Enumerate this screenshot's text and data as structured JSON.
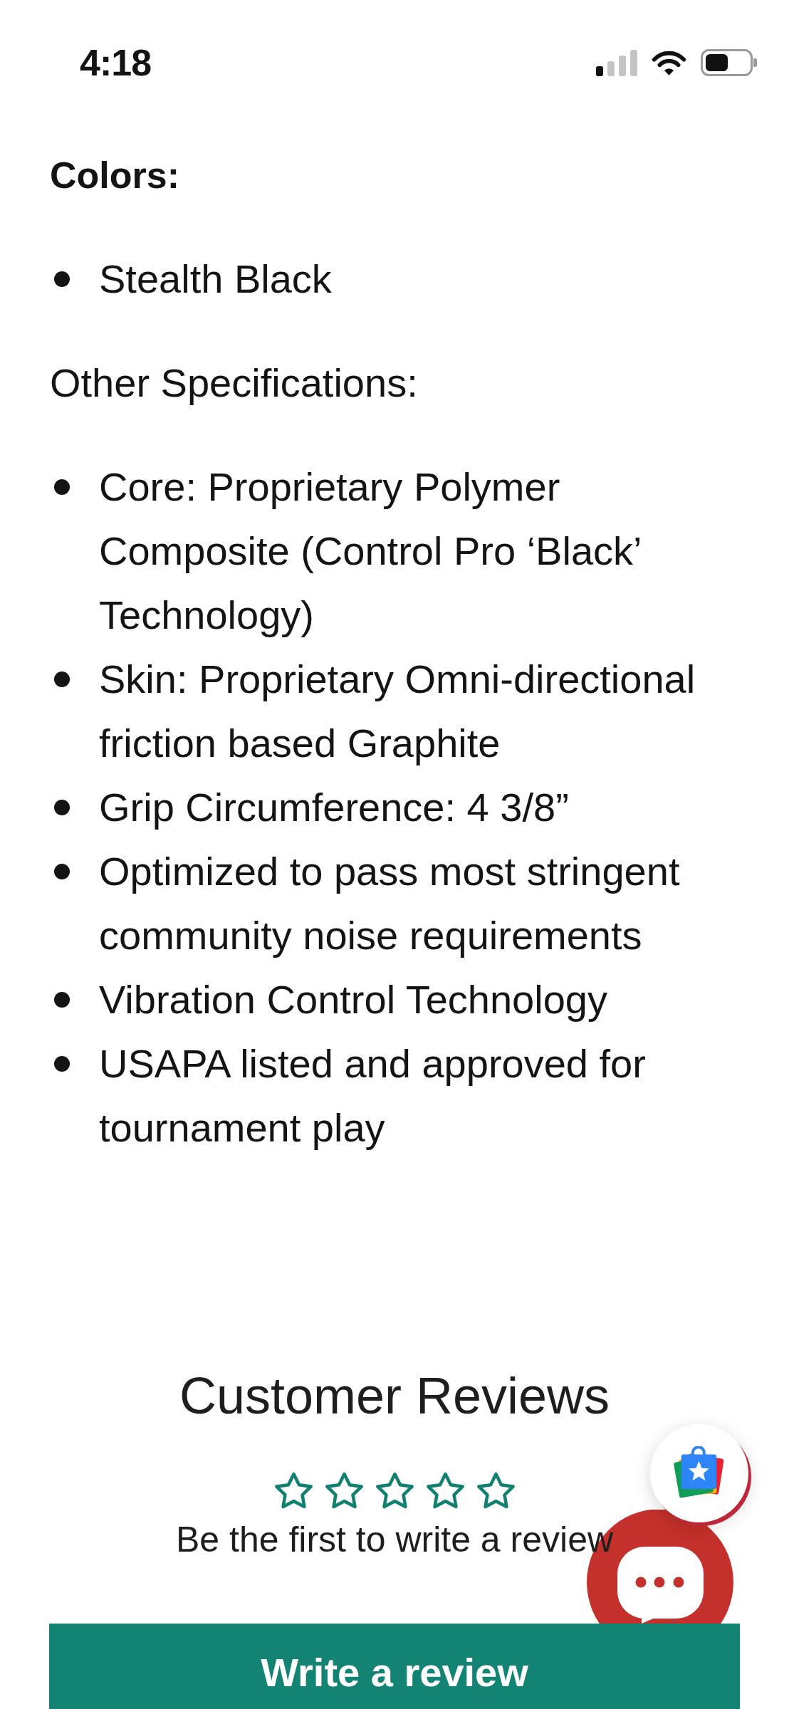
{
  "status_bar": {
    "time": "4:18"
  },
  "colors": {
    "heading": "Colors:",
    "items": [
      "Stealth Black"
    ]
  },
  "specifications": {
    "heading": "Other Specifications:",
    "items": [
      "Core: Proprietary Polymer Composite (Control Pro ‘Black’ Technology)",
      "Skin: Proprietary Omni-directional friction based Graphite",
      "Grip Circumference: 4 3/8”",
      "Optimized to pass most stringent community noise requirements",
      "Vibration Control Technology",
      "USAPA listed and approved for tournament play"
    ]
  },
  "reviews": {
    "title": "Customer Reviews",
    "stars": 0,
    "prompt": "Be the first to write a review",
    "button": "Write a review"
  }
}
